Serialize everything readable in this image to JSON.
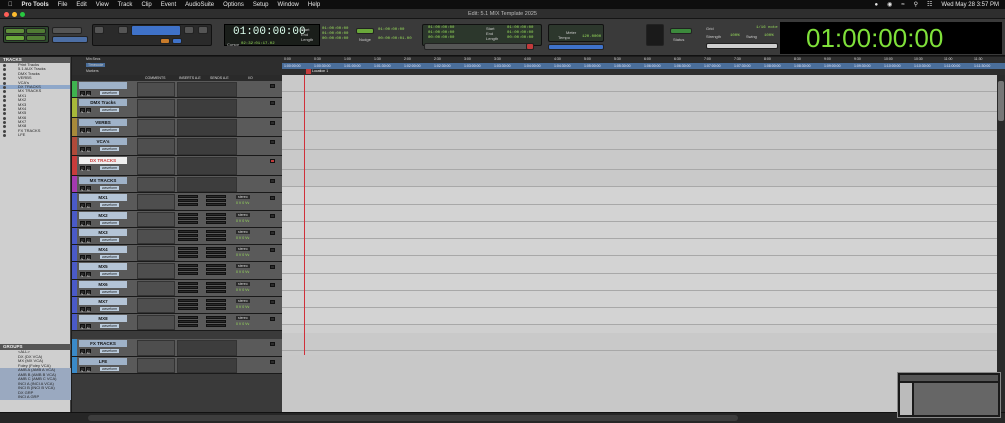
{
  "menubar": {
    "app": "Pro Tools",
    "items": [
      "File",
      "Edit",
      "View",
      "Track",
      "Clip",
      "Event",
      "AudioSuite",
      "Options",
      "Setup",
      "Window",
      "Help"
    ],
    "datetime": "Wed May 28  3:57 PM"
  },
  "window": {
    "title": "Edit: 5.1 MIX Template 2025"
  },
  "toolbar": {
    "main_counter": "01:00:00:00",
    "sub_counter_label": "Cursor",
    "sub_counter": "02:32:01:17.02",
    "start_label": "Start",
    "end_label": "End",
    "length_label": "Length",
    "start": "01:00:00:00",
    "end": "01:00:00:00",
    "length": "00:00:00:00",
    "nudge_label": "Nudge",
    "nudge": "00:00:00:01.00",
    "grid_label": "Grid",
    "grid": "1/16 note",
    "strength_label": "Strength",
    "strength": "100%",
    "swing_label": "Swing",
    "swing": "100%",
    "status_label": "Status",
    "meter_label": "Meter",
    "tempo_label": "Tempo",
    "tempo": "120.0000",
    "big_counter": "01:00:00:00"
  },
  "rulers": {
    "labels": [
      "Min:Secs",
      "Timecode",
      "Markers"
    ],
    "minsecs": [
      "0:00",
      "0:30",
      "1:00",
      "1:30",
      "2:00",
      "2:30",
      "3:00",
      "3:30",
      "4:00",
      "4:30",
      "5:00",
      "5:30",
      "6:00",
      "6:30",
      "7:00",
      "7:30",
      "8:00",
      "8:30",
      "9:00",
      "9:30",
      "10:00",
      "10:30",
      "11:00",
      "11:30"
    ],
    "timecode": [
      "1:00:00:00",
      "1:00:30:00",
      "1:01:00:00",
      "1:01:30:00",
      "1:02:00:00",
      "1:02:30:00",
      "1:03:00:00",
      "1:03:30:00",
      "1:04:00:00",
      "1:04:30:00",
      "1:05:00:00",
      "1:05:30:00",
      "1:06:00:00",
      "1:06:30:00",
      "1:07:00:00",
      "1:07:30:00",
      "1:08:00:00",
      "1:08:30:00",
      "1:09:00:00",
      "1:09:30:00",
      "1:10:00:00",
      "1:10:30:00",
      "1:11:00:00",
      "1:11:30:00"
    ],
    "marker": "Location 1"
  },
  "column_headers": [
    "COMMENTS",
    "INSERTS A-E",
    "SENDS A-E",
    "I/O"
  ],
  "tracks_panel": {
    "title": "TRACKS",
    "items": [
      "Print Tracks",
      "5.1 AUX Tracks",
      "DMX Tracks",
      "VERBS",
      "VCA's",
      "DX TRACKS",
      "MX TRACKS",
      "MX1",
      "MX2",
      "MX3",
      "MX4",
      "MX5",
      "MX6",
      "MX7",
      "MX8",
      "FX TRACKS",
      "LFE"
    ]
  },
  "groups_panel": {
    "title": "GROUPS",
    "items": [
      "<ALL>",
      "DX (DX VCA)",
      "MX (MX VCA)",
      "Foley (Foley VCA)",
      "AMB A (AMB A VCA)",
      "AMB B (AMB B VCA)",
      "AMB C (AMB C VCA)",
      "INCI A (INCI A VCA)",
      "INCI B (INCI B VCA)",
      "DX GRP",
      "INCI A GRP"
    ]
  },
  "tracks": [
    {
      "name": "",
      "color": "#3fb34f",
      "type": "folder"
    },
    {
      "name": "DMX Tracks",
      "color": "#a7b93a",
      "type": "folder"
    },
    {
      "name": "VERBS",
      "color": "#a88a3a",
      "type": "folder"
    },
    {
      "name": "VCA's",
      "color": "#b04a3a",
      "type": "folder"
    },
    {
      "name": "DX TRACKS",
      "color": "#c83c3c",
      "type": "folder"
    },
    {
      "name": "MX TRACKS",
      "color": "#a43ab0",
      "type": "folder"
    },
    {
      "name": "MX1",
      "color": "#4a5ac8",
      "type": "audio"
    },
    {
      "name": "MX2",
      "color": "#4a5ac8",
      "type": "audio"
    },
    {
      "name": "MX3",
      "color": "#4a5ac8",
      "type": "audio"
    },
    {
      "name": "MX4",
      "color": "#4a5ac8",
      "type": "audio"
    },
    {
      "name": "MX5",
      "color": "#4a5ac8",
      "type": "audio"
    },
    {
      "name": "MX6",
      "color": "#4a5ac8",
      "type": "audio"
    },
    {
      "name": "MX7",
      "color": "#4a5ac8",
      "type": "audio"
    },
    {
      "name": "MX8",
      "color": "#4a5ac8",
      "type": "audio"
    },
    {
      "name": "FX TRACKS",
      "color": "#3a8ac8",
      "type": "folder"
    },
    {
      "name": "LFE",
      "color": "#3a8ac8",
      "type": "folder"
    }
  ],
  "track_view": "waveform",
  "io_label": "stereo",
  "nums": "0 V  0 Vv",
  "track_buttons": [
    "S",
    "M"
  ]
}
